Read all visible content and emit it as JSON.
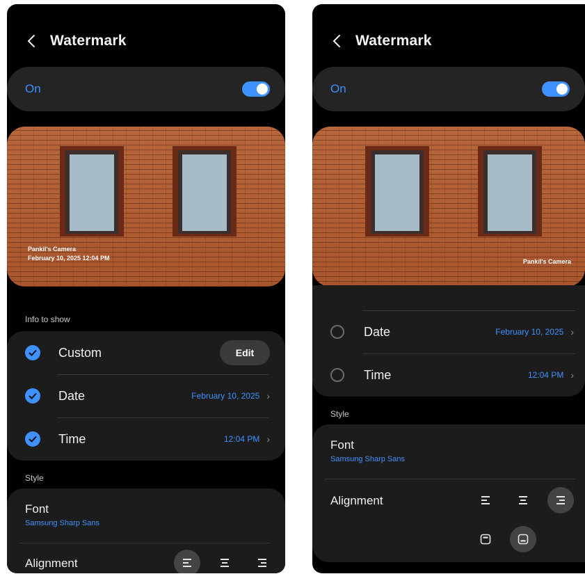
{
  "left_screen": {
    "title": "Watermark",
    "toggle": {
      "label": "On",
      "state": true
    },
    "photo": {
      "watermark_line1": "Pankil's Camera",
      "watermark_line2": "February 10, 2025 12:04 PM"
    },
    "info_header": "Info to show",
    "info_rows": [
      {
        "label": "Custom",
        "checked": true,
        "action": "Edit"
      },
      {
        "label": "Date",
        "checked": true,
        "value": "February 10, 2025"
      },
      {
        "label": "Time",
        "checked": true,
        "value": "12:04 PM"
      }
    ],
    "style_header": "Style",
    "font_label": "Font",
    "font_value": "Samsung Sharp Sans",
    "alignment_label": "Alignment",
    "alignment_selected": "left"
  },
  "right_screen": {
    "title": "Watermark",
    "toggle": {
      "label": "On",
      "state": true
    },
    "photo": {
      "watermark_line1": "Pankil's Camera"
    },
    "info_rows": [
      {
        "label": "Date",
        "checked": false,
        "value": "February 10, 2025"
      },
      {
        "label": "Time",
        "checked": false,
        "value": "12:04 PM"
      }
    ],
    "style_header": "Style",
    "font_label": "Font",
    "font_value": "Samsung Sharp Sans",
    "alignment_label": "Alignment",
    "alignment_selected": "right",
    "vertical_selected": "bottom"
  },
  "colors": {
    "accent": "#3e91ff",
    "background": "#000000",
    "card": "#1c1c1c"
  }
}
